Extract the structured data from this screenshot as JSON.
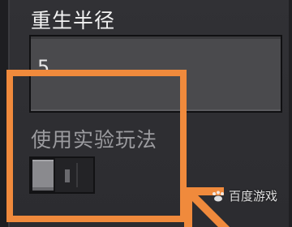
{
  "setting": {
    "title": "重生半径",
    "input_value": "5",
    "toggle_label": "使用实验玩法",
    "toggle_on": false
  },
  "overlay": {
    "highlight_color": "#f08a3c",
    "watermark_text": "百度游戏"
  }
}
